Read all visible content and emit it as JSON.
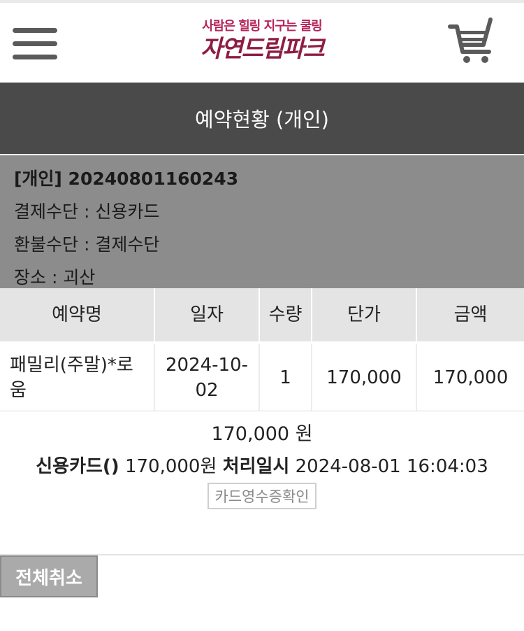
{
  "header": {
    "slogan": "사람은 힐링 지구는 쿨링",
    "brand": "자연드림파크",
    "brand_color": "#8e1d45",
    "menu_icon": "hamburger-menu-icon",
    "cart_icon": "shopping-cart-icon"
  },
  "page": {
    "title": "예약현황 (개인)"
  },
  "reservation": {
    "id_line": "[개인] 20240801160243",
    "payment_method": "결제수단 : 신용카드",
    "refund_method": "환불수단 : 결제수단",
    "location": "장소 : 괴산"
  },
  "table": {
    "headers": [
      "예약명",
      "일자",
      "수량",
      "단가",
      "금액"
    ],
    "rows": [
      {
        "name": "패밀리(주말)*로움",
        "date": "2024-10-02",
        "qty": "1",
        "unit_price": "170,000",
        "amount": "170,000"
      }
    ]
  },
  "summary": {
    "total": "170,000 원",
    "card_label": "신용카드()",
    "card_amount": "170,000원",
    "processed_label": "처리일시",
    "processed_at": "2024-08-01 16:04:03",
    "receipt_button": "카드영수증확인"
  },
  "actions": {
    "cancel_all": "전체취소"
  }
}
